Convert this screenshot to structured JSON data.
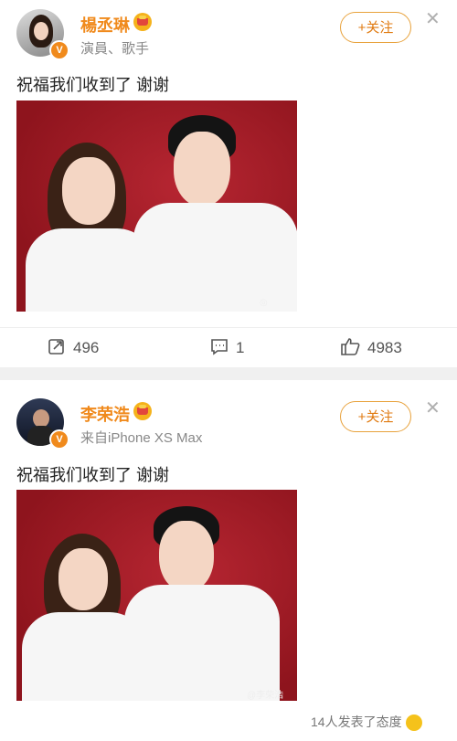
{
  "posts": [
    {
      "name": "楊丞琳",
      "subtitle": "演員、歌手",
      "follow_label": "+关注",
      "text": "祝福我们收到了 谢谢",
      "repost_count": "496",
      "comment_count": "1",
      "like_count": "4983"
    },
    {
      "name": "李荣浩",
      "subtitle": "来自iPhone XS Max",
      "follow_label": "+关注",
      "text": "祝福我们收到了 谢谢",
      "watermark": "@李荣浩"
    }
  ],
  "footer": {
    "text": "14人发表了态度"
  },
  "colors": {
    "accent": "#f08a1c",
    "photo_bg": "#a01a23"
  }
}
